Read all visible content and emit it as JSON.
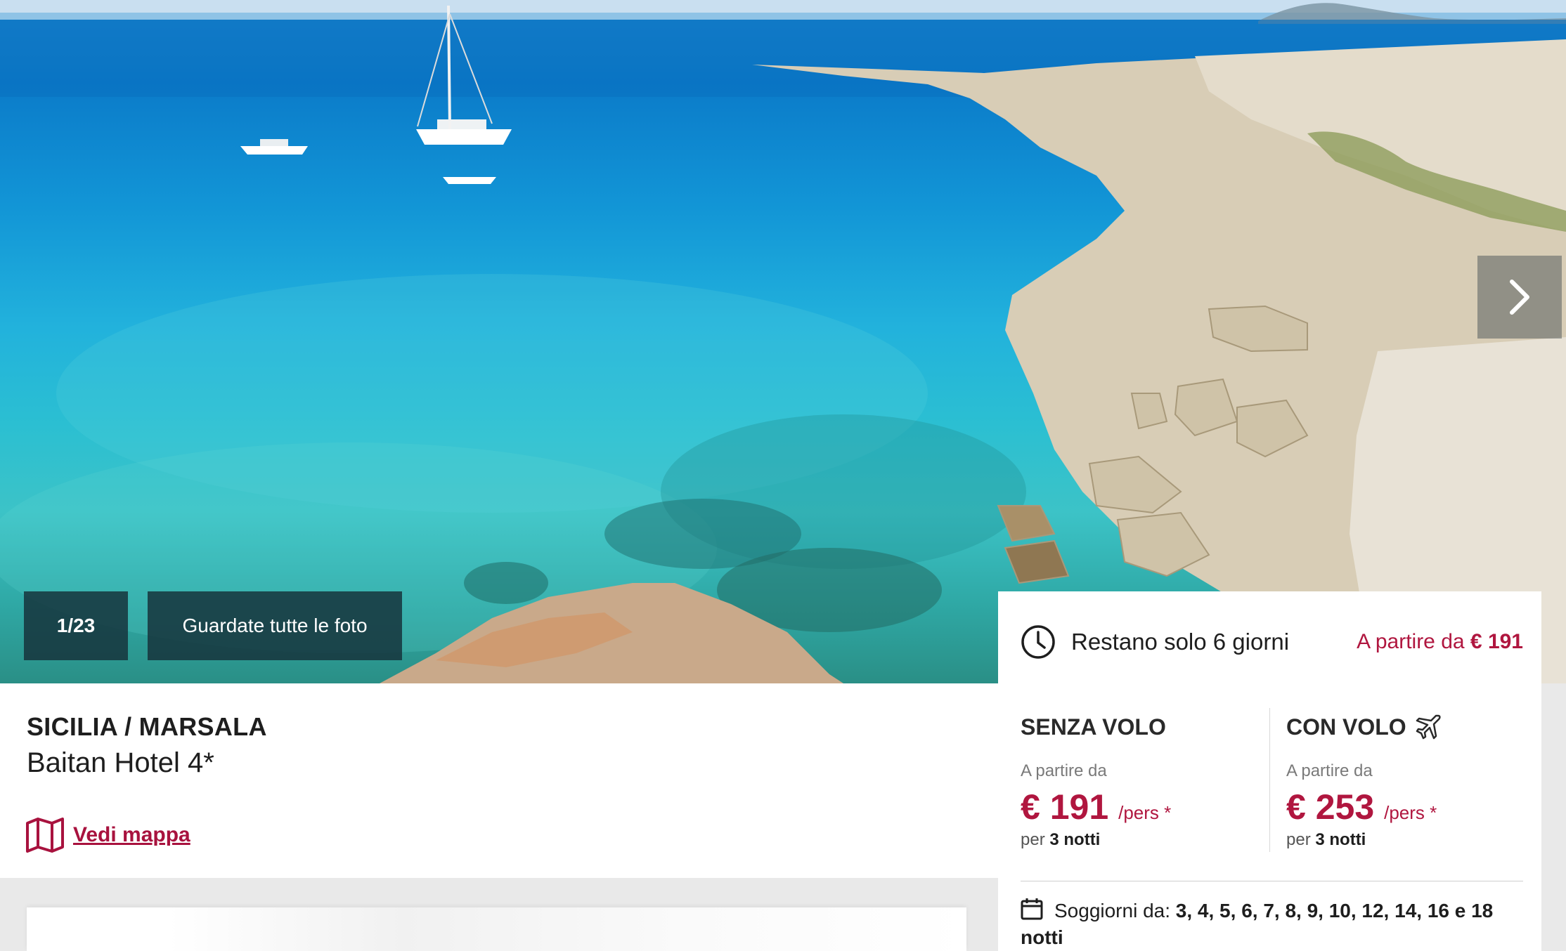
{
  "gallery": {
    "counter": "1/23",
    "view_all_label": "Guardate tutte le foto"
  },
  "hotel": {
    "region": "SICILIA / MARSALA",
    "name": "Baitan Hotel 4*",
    "map_link": "Vedi mappa"
  },
  "offer": {
    "deadline": "Restano solo 6 giorni",
    "from_label": "A partire da",
    "from_price": "€ 191",
    "without_flight": {
      "title": "SENZA VOLO",
      "from_label": "A partire da",
      "price": "€ 191",
      "per_person": "/pers *",
      "nights_prefix": "per",
      "nights": "3 notti"
    },
    "with_flight": {
      "title": "CON VOLO",
      "from_label": "A partire da",
      "price": "€ 253",
      "per_person": "/pers *",
      "nights_prefix": "per",
      "nights": "3 notti"
    },
    "stays_label": "Soggiorni da:",
    "stays_values": "3, 4, 5, 6, 7, 8, 9, 10, 12, 14, 16 e 18 notti"
  },
  "colors": {
    "accent": "#b0163f",
    "link": "#a8123e",
    "badge_bg": "#16343c"
  },
  "icons": {
    "next": "chevron-right-icon",
    "clock": "clock-icon",
    "plane": "plane-icon",
    "map": "map-icon",
    "calendar": "calendar-icon"
  }
}
